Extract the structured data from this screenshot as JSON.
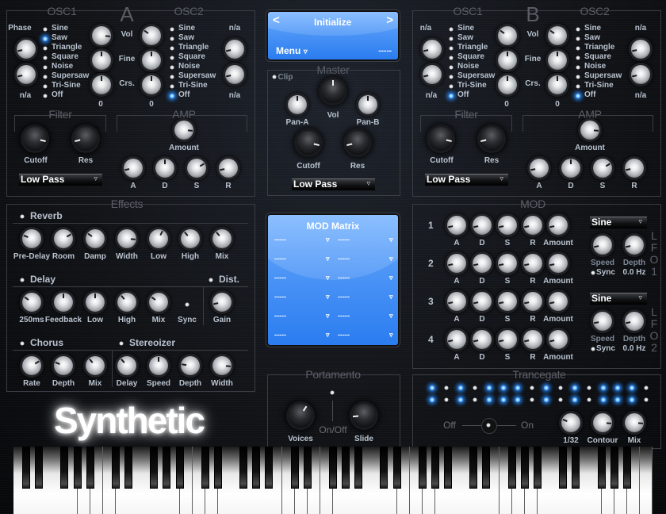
{
  "app_name": "Synthetic",
  "colors": {
    "accent_led": "#1e7de8",
    "lcd_blue": "#4f97f7",
    "frame": "#3a3d44"
  },
  "section_a": {
    "letter": "A",
    "osc1_title": "OSC1",
    "osc2_title": "OSC2",
    "osc1": {
      "left_top_label": "Phase",
      "left_bottom_label": "n/a",
      "left_knobs": [
        0.12,
        0.12
      ],
      "waveforms": [
        "Sine",
        "Saw",
        "Triangle",
        "Square",
        "Noise",
        "Supersaw",
        "Tri-Sine",
        "Off"
      ],
      "selected": "Saw"
    },
    "center": {
      "labels": [
        "Vol",
        "Fine",
        "Crs."
      ],
      "osc1_knobs": [
        0.85,
        0.5,
        0.5
      ],
      "osc2_knobs": [
        0.3,
        0.5,
        0.5
      ],
      "osc1_coarse_value": "0",
      "osc2_coarse_value": "0"
    },
    "osc2": {
      "right_top_label": "n/a",
      "right_bottom_label": "n/a",
      "right_knobs": [
        0.12,
        0.12
      ],
      "waveforms": [
        "Sine",
        "Saw",
        "Triangle",
        "Square",
        "Noise",
        "Supersaw",
        "Tri-Sine",
        "Off"
      ],
      "selected": "Off"
    },
    "filter": {
      "title": "Filter",
      "cutoff_label": "Cutoff",
      "res_label": "Res",
      "cutoff": 0.88,
      "res": 0.12,
      "type": "Low Pass"
    },
    "amp": {
      "title": "AMP",
      "amount_label": "Amount",
      "amount": 0.85,
      "adsr": [
        {
          "label": "A",
          "value": 0.12
        },
        {
          "label": "D",
          "value": 0.5
        },
        {
          "label": "S",
          "value": 0.72
        },
        {
          "label": "R",
          "value": 0.12
        }
      ]
    }
  },
  "section_b": {
    "letter": "B",
    "osc1_title": "OSC1",
    "osc2_title": "OSC2",
    "osc1": {
      "left_top_label": "n/a",
      "left_bottom_label": "n/a",
      "left_knobs": [
        0.12,
        0.12
      ],
      "waveforms": [
        "Sine",
        "Saw",
        "Triangle",
        "Square",
        "Noise",
        "Supersaw",
        "Tri-Sine",
        "Off"
      ],
      "selected": "Off"
    },
    "center": {
      "labels": [
        "Vol",
        "Fine",
        "Crs."
      ],
      "osc1_knobs": [
        0.3,
        0.5,
        0.5
      ],
      "osc2_knobs": [
        0.3,
        0.5,
        0.5
      ],
      "osc1_coarse_value": "0",
      "osc2_coarse_value": "0"
    },
    "osc2": {
      "right_top_label": "n/a",
      "right_bottom_label": "n/a",
      "right_knobs": [
        0.12,
        0.12
      ],
      "waveforms": [
        "Sine",
        "Saw",
        "Triangle",
        "Square",
        "Noise",
        "Supersaw",
        "Tri-Sine",
        "Off"
      ],
      "selected": "Off"
    },
    "filter": {
      "title": "Filter",
      "cutoff_label": "Cutoff",
      "res_label": "Res",
      "cutoff": 0.88,
      "res": 0.12,
      "type": "Low Pass"
    },
    "amp": {
      "title": "AMP",
      "amount_label": "Amount",
      "amount": 0.85,
      "adsr": [
        {
          "label": "A",
          "value": 0.12
        },
        {
          "label": "D",
          "value": 0.5
        },
        {
          "label": "S",
          "value": 0.72
        },
        {
          "label": "R",
          "value": 0.12
        }
      ]
    }
  },
  "preset": {
    "prev": "<",
    "name": "Initialize",
    "next": ">",
    "menu": "Menu",
    "menu_arrow": "▿",
    "value": "-----"
  },
  "master": {
    "title": "Master",
    "clip_label": "Clip",
    "vol_label": "Vol",
    "vol": 0.5,
    "pan_a_label": "Pan-A",
    "pan_a": 0.5,
    "pan_b_label": "Pan-B",
    "pan_b": 0.5,
    "cutoff_label": "Cutoff",
    "cutoff": 0.88,
    "res_label": "Res",
    "res": 0.12,
    "filter_type": "Low Pass"
  },
  "effects": {
    "title": "Effects",
    "reverb": {
      "title": "Reverb",
      "knobs": [
        {
          "label": "Pre-Delay",
          "value": 0.25
        },
        {
          "label": "Room",
          "value": 0.72
        },
        {
          "label": "Damp",
          "value": 0.3
        },
        {
          "label": "Width",
          "value": 0.85
        },
        {
          "label": "Low",
          "value": 0.6
        },
        {
          "label": "High",
          "value": 0.35
        },
        {
          "label": "Mix",
          "value": 0.35
        }
      ]
    },
    "delay": {
      "title": "Delay",
      "knobs": [
        {
          "label": "250ms",
          "value": 0.3
        },
        {
          "label": "Feedback",
          "value": 0.5
        },
        {
          "label": "Low",
          "value": 0.5
        },
        {
          "label": "High",
          "value": 0.35
        },
        {
          "label": "Mix",
          "value": 0.3
        }
      ],
      "sync_label": "Sync"
    },
    "distortion": {
      "title": "Dist.",
      "knobs": [
        {
          "label": "Gain",
          "value": 0.12
        }
      ]
    },
    "chorus": {
      "title": "Chorus",
      "knobs": [
        {
          "label": "Rate",
          "value": 0.72
        },
        {
          "label": "Depth",
          "value": 0.25
        },
        {
          "label": "Mix",
          "value": 0.35
        }
      ]
    },
    "stereoizer": {
      "title": "Stereoizer",
      "knobs": [
        {
          "label": "Delay",
          "value": 0.35
        },
        {
          "label": "Speed",
          "value": 0.5
        },
        {
          "label": "Depth",
          "value": 0.2
        },
        {
          "label": "Width",
          "value": 0.85
        }
      ]
    }
  },
  "mod_matrix": {
    "title": "MOD Matrix",
    "rows": [
      {
        "source": "-----",
        "dest": "-----"
      },
      {
        "source": "-----",
        "dest": "-----"
      },
      {
        "source": "-----",
        "dest": "-----"
      },
      {
        "source": "-----",
        "dest": "-----"
      },
      {
        "source": "-----",
        "dest": "-----"
      },
      {
        "source": "-----",
        "dest": "-----"
      }
    ],
    "arrow": "▿"
  },
  "mod": {
    "title": "MOD",
    "envelopes": [
      {
        "number": "1",
        "knobs": [
          {
            "label": "A",
            "value": 0.12
          },
          {
            "label": "D",
            "value": 0.12
          },
          {
            "label": "S",
            "value": 0.12
          },
          {
            "label": "R",
            "value": 0.12
          },
          {
            "label": "Amount",
            "value": 0.12
          }
        ]
      },
      {
        "number": "2",
        "knobs": [
          {
            "label": "A",
            "value": 0.12
          },
          {
            "label": "D",
            "value": 0.12
          },
          {
            "label": "S",
            "value": 0.12
          },
          {
            "label": "R",
            "value": 0.12
          },
          {
            "label": "Amount",
            "value": 0.12
          }
        ]
      },
      {
        "number": "3",
        "knobs": [
          {
            "label": "A",
            "value": 0.12
          },
          {
            "label": "D",
            "value": 0.12
          },
          {
            "label": "S",
            "value": 0.12
          },
          {
            "label": "R",
            "value": 0.12
          },
          {
            "label": "Amount",
            "value": 0.12
          }
        ]
      },
      {
        "number": "4",
        "knobs": [
          {
            "label": "A",
            "value": 0.12
          },
          {
            "label": "D",
            "value": 0.12
          },
          {
            "label": "S",
            "value": 0.12
          },
          {
            "label": "R",
            "value": 0.12
          },
          {
            "label": "Amount",
            "value": 0.12
          }
        ]
      }
    ],
    "lfos": [
      {
        "title_chars": [
          "L",
          "F",
          "O",
          "1"
        ],
        "waveform": "Sine",
        "speed_label": "Speed",
        "speed": 0.12,
        "depth_label": "Depth",
        "depth": 0.12,
        "sync_label": "Sync",
        "rate_value": "0.0 Hz"
      },
      {
        "title_chars": [
          "L",
          "F",
          "O",
          "2"
        ],
        "waveform": "Sine",
        "speed_label": "Speed",
        "speed": 0.12,
        "depth_label": "Depth",
        "depth": 0.12,
        "sync_label": "Sync",
        "rate_value": "0.0 Hz"
      }
    ]
  },
  "portamento": {
    "title": "Portamento",
    "voices_label": "Voices",
    "voices": 0.62,
    "slide_label": "Slide",
    "slide": 0.15,
    "onoff_label": "On/Off"
  },
  "trancegate": {
    "title": "Trancegate",
    "row1": [
      1,
      0,
      1,
      0,
      1,
      1,
      1,
      0,
      1,
      0,
      1,
      0,
      1,
      1,
      1,
      0
    ],
    "row2": [
      1,
      0,
      1,
      0,
      1,
      1,
      1,
      0,
      1,
      0,
      1,
      0,
      1,
      1,
      1,
      0
    ],
    "off_label": "Off",
    "on_label": "On",
    "knobs": [
      {
        "label": "1/32",
        "value": 0.25
      },
      {
        "label": "Contour",
        "value": 0.85
      },
      {
        "label": "Mix",
        "value": 0.85
      }
    ]
  },
  "keyboard": {
    "white_keys": 50,
    "start_note": "C"
  }
}
